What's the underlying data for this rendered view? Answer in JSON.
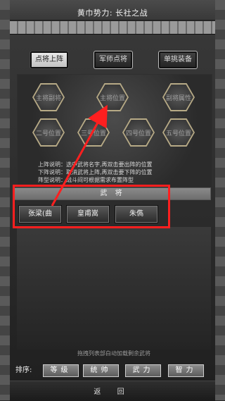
{
  "header": {
    "title": "黄巾势力: 长社之战"
  },
  "tabs": [
    {
      "label": "点将上阵"
    },
    {
      "label": "军师点将"
    },
    {
      "label": "单挑装备"
    }
  ],
  "formation": {
    "slots": [
      {
        "label": "主将副将"
      },
      {
        "label": "主将位置"
      },
      {
        "label": "副将属性"
      },
      {
        "label": "二号位置"
      },
      {
        "label": "三号位置"
      },
      {
        "label": "四号位置"
      },
      {
        "label": "五号位置"
      }
    ]
  },
  "instructions": [
    "上阵说明：选中武将名字,再双击要出阵的位置",
    "下阵说明：取消武将上阵,再双击要下阵的位置",
    "阵型说明：战斗间可根据需求布置阵型"
  ],
  "generals": {
    "header": "武  将",
    "items": [
      "张梁(曲",
      "皇甫嵩",
      "朱儁"
    ]
  },
  "drag_hint": "拖拽列表部白动加载剩余武将",
  "sort": {
    "label": "排序:",
    "buttons": [
      "等级",
      "统帅",
      "武力",
      "智力"
    ]
  },
  "footer": {
    "back_label": "返  回"
  },
  "annotations": {
    "box_color": "#ff1f1f",
    "arrow_color": "#ff1f1f"
  }
}
